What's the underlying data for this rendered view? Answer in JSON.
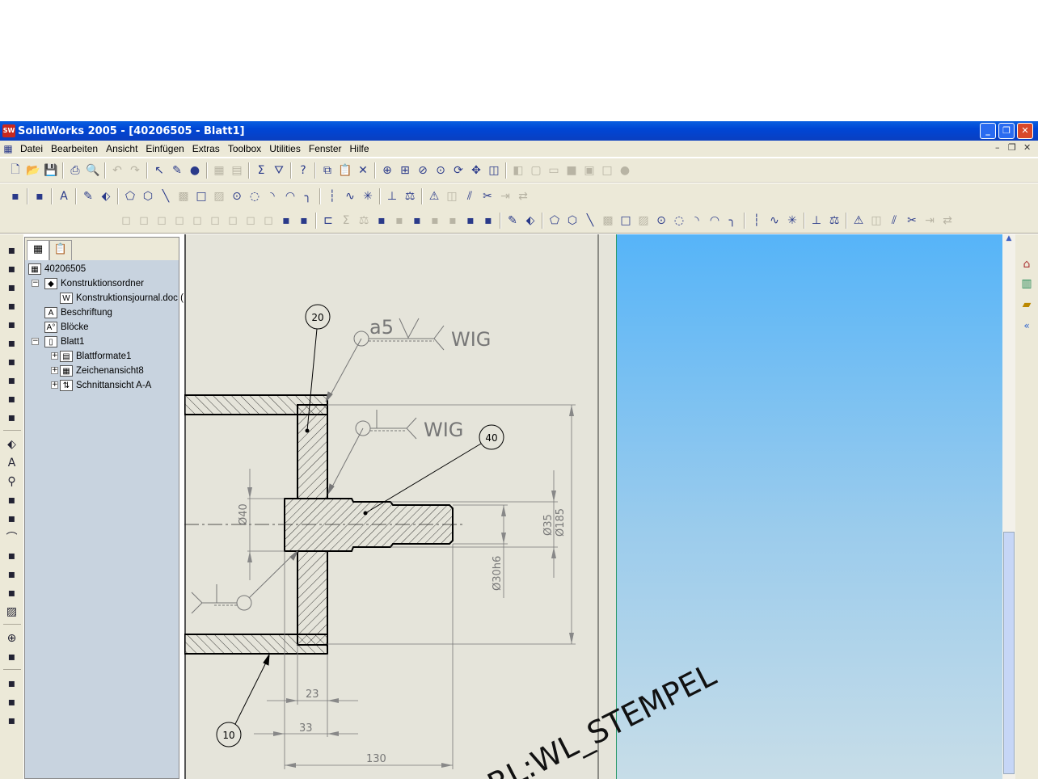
{
  "window": {
    "title": "SolidWorks 2005 - [40206505 - Blatt1]",
    "logo": "SW",
    "buttons": [
      "minimize",
      "restore",
      "close"
    ]
  },
  "menu": {
    "items": [
      "Datei",
      "Bearbeiten",
      "Ansicht",
      "Einfügen",
      "Extras",
      "Toolbox",
      "Utilities",
      "Fenster",
      "Hilfe"
    ]
  },
  "toolbars": {
    "row1": [
      "new-document",
      "open-folder",
      "save",
      "|",
      "print",
      "print-preview",
      "|",
      "undo",
      "redo",
      "|",
      "select-arrow",
      "sketch",
      "rebuild-traffic-light",
      "|",
      "grid",
      "layers",
      "|",
      "equations",
      "filter",
      "|",
      "help",
      "|",
      "copy",
      "paste",
      "delete",
      "|",
      "zoom-fit",
      "zoom-area",
      "zoom-in-out",
      "zoom-selection",
      "rotate",
      "pan",
      "view-orientation",
      "|",
      "iso-view",
      "front-view",
      "top-view",
      "shaded",
      "hidden-lines",
      "wireframe",
      "sphere"
    ],
    "row2": [
      "drawing-tools",
      "|",
      "sketch-tools",
      "|",
      "annotation",
      "|",
      "sketch",
      "smart-dimension",
      "|",
      "polygon",
      "hexagon",
      "line",
      "rectangle-filled",
      "rectangle",
      "hatch",
      "circle",
      "arc-3pt",
      "tangent-arc",
      "centerpoint-arc",
      "fillet-arc",
      "|",
      "centerline",
      "spline",
      "point",
      "|",
      "dimension-base",
      "measure",
      "|",
      "warning",
      "mirror",
      "offset",
      "trim",
      "extend",
      "convert"
    ],
    "row3": [
      "box-1",
      "box-2",
      "box-3",
      "box-4",
      "box-5",
      "box-6",
      "box-7",
      "box-8",
      "box-9",
      "anchor",
      "probe",
      "|",
      "tape",
      "sum",
      "balance",
      "folder-paint",
      "check",
      "table-x",
      "parts",
      "bars",
      "sketch-rule",
      "filter-menu",
      "|",
      "sketch",
      "smart-dimension",
      "|",
      "polygon",
      "hexagon",
      "line",
      "rectangle-filled",
      "rectangle",
      "hatch",
      "circle",
      "arc-3pt",
      "tangent-arc",
      "centerpoint-arc",
      "fillet-arc",
      "|",
      "centerline",
      "spline",
      "point",
      "|",
      "dimension-base",
      "measure",
      "|",
      "warning",
      "mirror",
      "offset",
      "trim",
      "extend",
      "convert"
    ]
  },
  "left_toolbar": [
    "balloon-tag",
    "model-view",
    "projected-view",
    "detail-view",
    "section-view",
    "aligned-section",
    "broken-view",
    "crop-view",
    "alt-position",
    "relative-view",
    "|",
    "smart-dimension",
    "note",
    "balloon",
    "auto-balloon",
    "surface-finish",
    "weld-symbol",
    "geometric-tolerance",
    "datum-feature",
    "datum-target",
    "area-hatch",
    "|",
    "center-mark",
    "centerline-view",
    "|",
    "bom",
    "hole-table",
    "revision-table"
  ],
  "tree": {
    "tabs": [
      "feature-manager",
      "property-manager"
    ],
    "root": "40206505",
    "nodes": [
      {
        "label": "Konstruktionsordner",
        "level": 1,
        "expand": "−",
        "icon": "folder-diamond"
      },
      {
        "label": "Konstruktionsjournal.doc (",
        "level": 2,
        "expand": "",
        "icon": "word-doc"
      },
      {
        "label": "Beschriftung",
        "level": 1,
        "expand": "",
        "icon": "annotation-folder"
      },
      {
        "label": "Blöcke",
        "level": 1,
        "expand": "",
        "icon": "blocks-folder"
      },
      {
        "label": "Blatt1",
        "level": 1,
        "expand": "−",
        "icon": "sheet"
      },
      {
        "label": "Blattformate1",
        "level": 2,
        "expand": "+",
        "icon": "sheet-format"
      },
      {
        "label": "Zeichenansicht8",
        "level": 2,
        "expand": "+",
        "icon": "drawing-view"
      },
      {
        "label": "Schnittansicht A-A",
        "level": 2,
        "expand": "+",
        "icon": "section-view"
      }
    ]
  },
  "drawing": {
    "balloons": [
      "20",
      "40",
      "10"
    ],
    "weld": {
      "size": "a5",
      "process1": "WIG",
      "process2": "WIG"
    },
    "dimensions": {
      "d40": "Ø40",
      "d35": "Ø35",
      "d185": "Ø185",
      "d30h6": "Ø30h6",
      "l23": "23",
      "l33": "33",
      "l130": "130"
    },
    "stamp": "RL:WL_STEMPEL"
  },
  "taskpane": [
    "home-icon",
    "chart-icon",
    "folder-icon",
    "collapse-icon"
  ],
  "colors": {
    "titlebar": "#0046d5",
    "sheet": "#e5e4da",
    "tree": "#c8d3df",
    "viewport_top": "#56b4f8"
  }
}
